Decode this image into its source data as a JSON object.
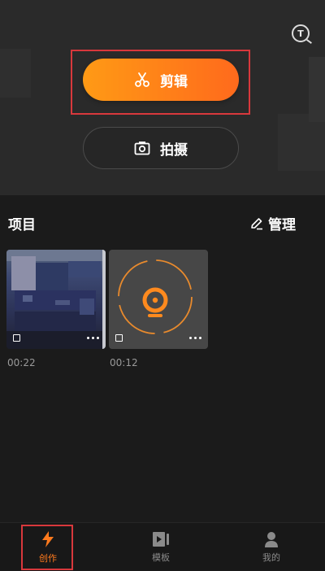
{
  "header": {
    "tutorial_icon_glyph": "T",
    "primary_action": {
      "label": "剪辑",
      "icon": "scissors-icon"
    },
    "secondary_action": {
      "label": "拍摄",
      "icon": "camera-icon"
    }
  },
  "projects": {
    "title": "项目",
    "manage_label": "管理",
    "items": [
      {
        "duration": "00:22",
        "thumbnail": "blurred-screen-recording"
      },
      {
        "duration": "00:12",
        "thumbnail": "camera-placeholder"
      }
    ]
  },
  "bottom_nav": {
    "items": [
      {
        "label": "创作",
        "icon": "lightning-icon",
        "active": true
      },
      {
        "label": "模板",
        "icon": "template-play-icon",
        "active": false
      },
      {
        "label": "我的",
        "icon": "person-icon",
        "active": false
      }
    ]
  },
  "colors": {
    "accent_start": "#ff9a15",
    "accent_end": "#ff6a1c",
    "highlight": "#d8383c",
    "background": "#1b1b1b"
  }
}
